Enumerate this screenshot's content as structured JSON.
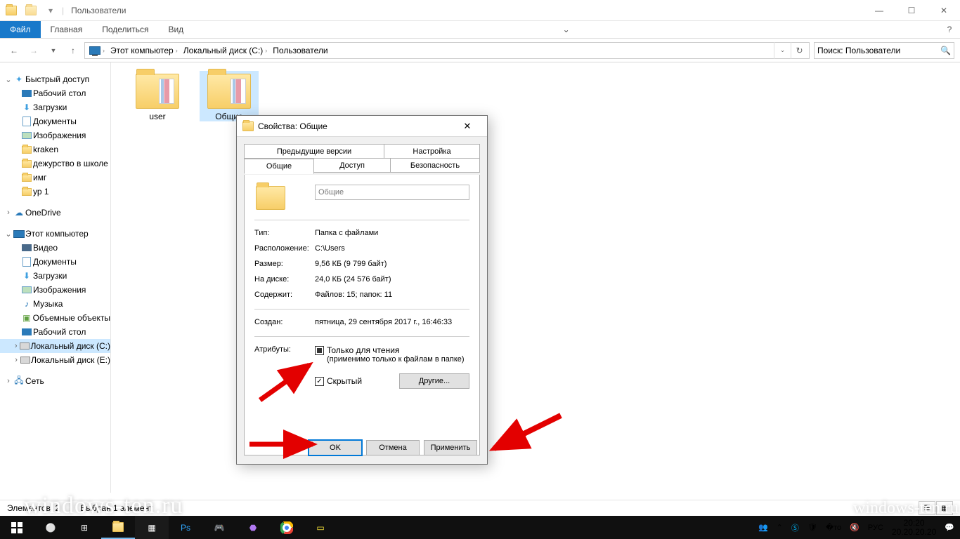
{
  "window": {
    "title": "Пользователи"
  },
  "ribbon": {
    "file": "Файл",
    "tabs": [
      "Главная",
      "Поделиться",
      "Вид"
    ]
  },
  "breadcrumb": [
    "Этот компьютер",
    "Локальный диск (C:)",
    "Пользователи"
  ],
  "search": {
    "placeholder": "Поиск: Пользователи"
  },
  "tree": {
    "quick": {
      "label": "Быстрый доступ",
      "items": [
        "Рабочий стол",
        "Загрузки",
        "Документы",
        "Изображения",
        "kraken",
        "дежурство в школе",
        "имг",
        "ур 1"
      ]
    },
    "onedrive": "OneDrive",
    "pc": {
      "label": "Этот компьютер",
      "items": [
        "Видео",
        "Документы",
        "Загрузки",
        "Изображения",
        "Музыка",
        "Объемные объекты",
        "Рабочий стол",
        "Локальный диск (C:)",
        "Локальный диск (E:)"
      ]
    },
    "network": "Сеть"
  },
  "files": [
    {
      "name": "user"
    },
    {
      "name": "Общие"
    }
  ],
  "statusbar": {
    "count": "Элементов: 2",
    "sel": "Выбран 1 элемент"
  },
  "dialog": {
    "title": "Свойства: Общие",
    "tabs_row2": [
      "Предыдущие версии",
      "Настройка"
    ],
    "tabs_row1": [
      "Общие",
      "Доступ",
      "Безопасность"
    ],
    "name_value": "Общие",
    "fields": {
      "type_l": "Тип:",
      "type_v": "Папка с файлами",
      "loc_l": "Расположение:",
      "loc_v": "C:\\Users",
      "size_l": "Размер:",
      "size_v": "9,56 КБ (9 799 байт)",
      "disk_l": "На диске:",
      "disk_v": "24,0 КБ (24 576 байт)",
      "cont_l": "Содержит:",
      "cont_v": "Файлов: 15; папок: 11",
      "created_l": "Создан:",
      "created_v": "пятница, 29 сентября 2017 г., 16:46:33",
      "attr_l": "Атрибуты:",
      "readonly": "Только для чтения",
      "readonly_note": "(применимо только к файлам в папке)",
      "hidden": "Скрытый",
      "other": "Другие..."
    },
    "buttons": {
      "ok": "OK",
      "cancel": "Отмена",
      "apply": "Применить"
    }
  },
  "taskbar": {
    "lang": "РУС",
    "time": "20:20",
    "date": "20.20.20.20"
  },
  "watermark": "windows-ten.ru"
}
